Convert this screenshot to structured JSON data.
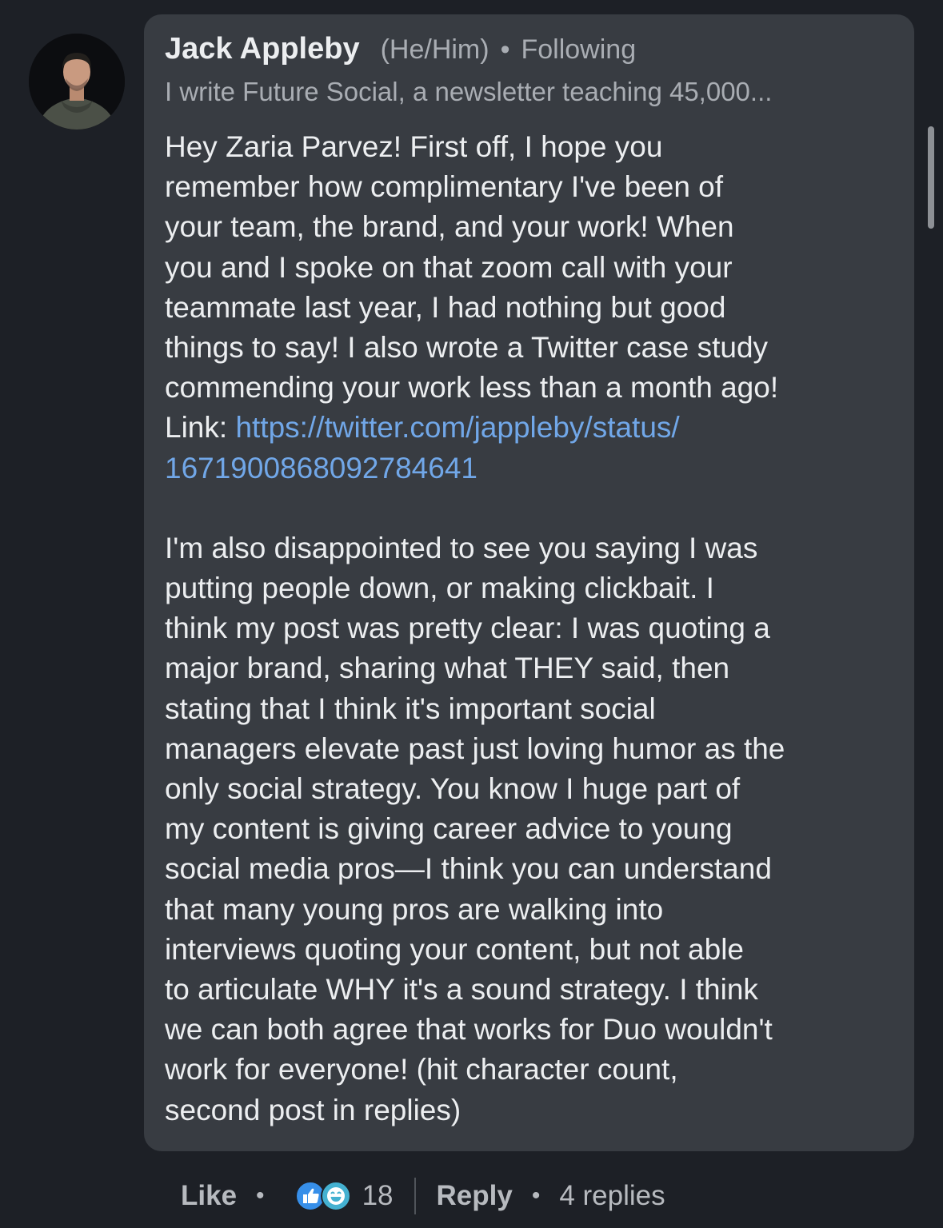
{
  "comment": {
    "author_name": "Jack Appleby",
    "pronouns": "(He/Him)",
    "separator": "•",
    "follow_status": "Following",
    "headline": "I write Future Social, a newsletter teaching 45,000...",
    "paragraph1_lines": [
      "Hey Zaria Parvez! First off, I hope you",
      "remember how complimentary I've been of",
      "your team, the brand, and your work! When",
      "you and I spoke on that zoom call with your",
      "teammate last year, I had nothing but good",
      "things to say! I also wrote a Twitter case study",
      "commending your work less than a month ago!"
    ],
    "link_prefix": "Link: ",
    "link_line1": "https://twitter.com/jappleby/status/",
    "link_line2": "1671900868092784641",
    "paragraph2_lines": [
      "I'm also disappointed to see you saying I was",
      "putting people down, or making clickbait. I",
      "think my post was pretty clear: I was quoting a",
      "major brand, sharing what THEY said, then",
      "stating that I think it's important social",
      "managers elevate past just loving humor as the",
      "only social strategy. You know I huge part of",
      "my content is giving career advice to young",
      "social media pros—I think you can understand",
      "that many young pros are walking into",
      "interviews quoting your content, but not able",
      "to articulate WHY it's a sound strategy. I think",
      "we can both agree that works for Duo wouldn't",
      "work for everyone! (hit character count,",
      "second post in replies)"
    ]
  },
  "actions": {
    "like_label": "Like",
    "dot": "•",
    "reaction_icons": [
      "like-reaction-icon",
      "funny-reaction-icon"
    ],
    "reaction_count": "18",
    "reply_label": "Reply",
    "replies_label": "4 replies"
  },
  "colors": {
    "background": "#1d2026",
    "bubble": "#383c42",
    "link": "#71a7e8",
    "like_reaction": "#378fe9",
    "funny_reaction": "#44b1d1"
  }
}
